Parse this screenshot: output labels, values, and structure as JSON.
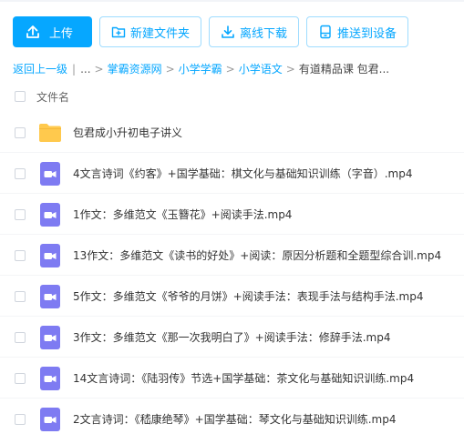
{
  "toolbar": {
    "upload_label": "上传",
    "new_folder_label": "新建文件夹",
    "offline_download_label": "离线下载",
    "push_to_device_label": "推送到设备"
  },
  "breadcrumb": {
    "back_label": "返回上一级",
    "pipe": "|",
    "ellipsis": "...",
    "items": [
      "掌霸资源网",
      "小学学霸",
      "小学语文"
    ],
    "current": "有道精品课 包君...",
    "separator": ">"
  },
  "list_header": {
    "label": "文件名"
  },
  "files": [
    {
      "name": "包君成小升初电子讲义",
      "icon": "folder-icon"
    },
    {
      "name": "4文言诗词《约客》+国学基础：棋文化与基础知识训练（字音）.mp4",
      "icon": "video-icon"
    },
    {
      "name": "1作文：多维范文《玉簪花》+阅读手法.mp4",
      "icon": "video-icon"
    },
    {
      "name": "13作文：多维范文《读书的好处》+阅读：原因分析题和全题型综合训.mp4",
      "icon": "video-icon"
    },
    {
      "name": "5作文：多维范文《爷爷的月饼》+阅读手法：表现手法与结构手法.mp4",
      "icon": "video-icon"
    },
    {
      "name": "3作文：多维范文《那一次我明白了》+阅读手法：修辞手法.mp4",
      "icon": "video-icon"
    },
    {
      "name": "14文言诗词：《陆羽传》节选+国学基础：茶文化与基础知识训练.mp4",
      "icon": "video-icon"
    },
    {
      "name": "2文言诗词：《嵇康绝琴》+国学基础：琴文化与基础知识训练.mp4",
      "icon": "video-icon"
    }
  ],
  "colors": {
    "accent": "#06a7ff",
    "folder": "#ffc94d",
    "video": "#7e7bf2"
  }
}
